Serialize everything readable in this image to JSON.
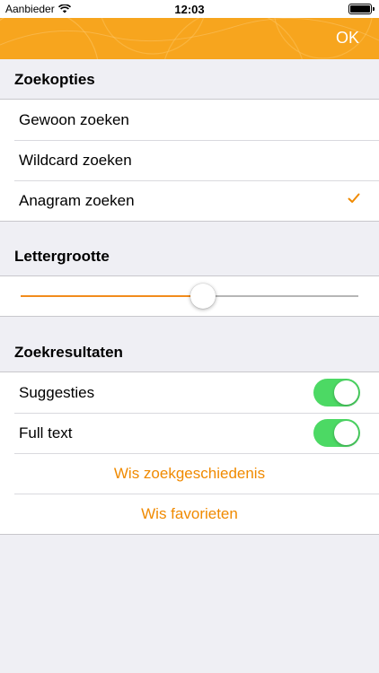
{
  "status_bar": {
    "carrier": "Aanbieder",
    "time": "12:03",
    "wifi_icon": "wifi-icon",
    "battery_icon": "battery-icon"
  },
  "navbar": {
    "ok_label": "OK",
    "color": "#f7a51e"
  },
  "search_options": {
    "header": "Zoekopties",
    "items": [
      {
        "label": "Gewoon zoeken",
        "selected": false
      },
      {
        "label": "Wildcard zoeken",
        "selected": false
      },
      {
        "label": "Anagram zoeken",
        "selected": true
      }
    ]
  },
  "font_size": {
    "header": "Lettergrootte",
    "slider_value": 0.54
  },
  "search_results": {
    "header": "Zoekresultaten",
    "toggles": [
      {
        "label": "Suggesties",
        "on": true
      },
      {
        "label": "Full text",
        "on": true
      }
    ],
    "actions": [
      {
        "label": "Wis zoekgeschiedenis"
      },
      {
        "label": "Wis favorieten"
      }
    ]
  },
  "colors": {
    "accent": "#f08a00",
    "toggle_on": "#4cd964",
    "background": "#efeff4"
  }
}
